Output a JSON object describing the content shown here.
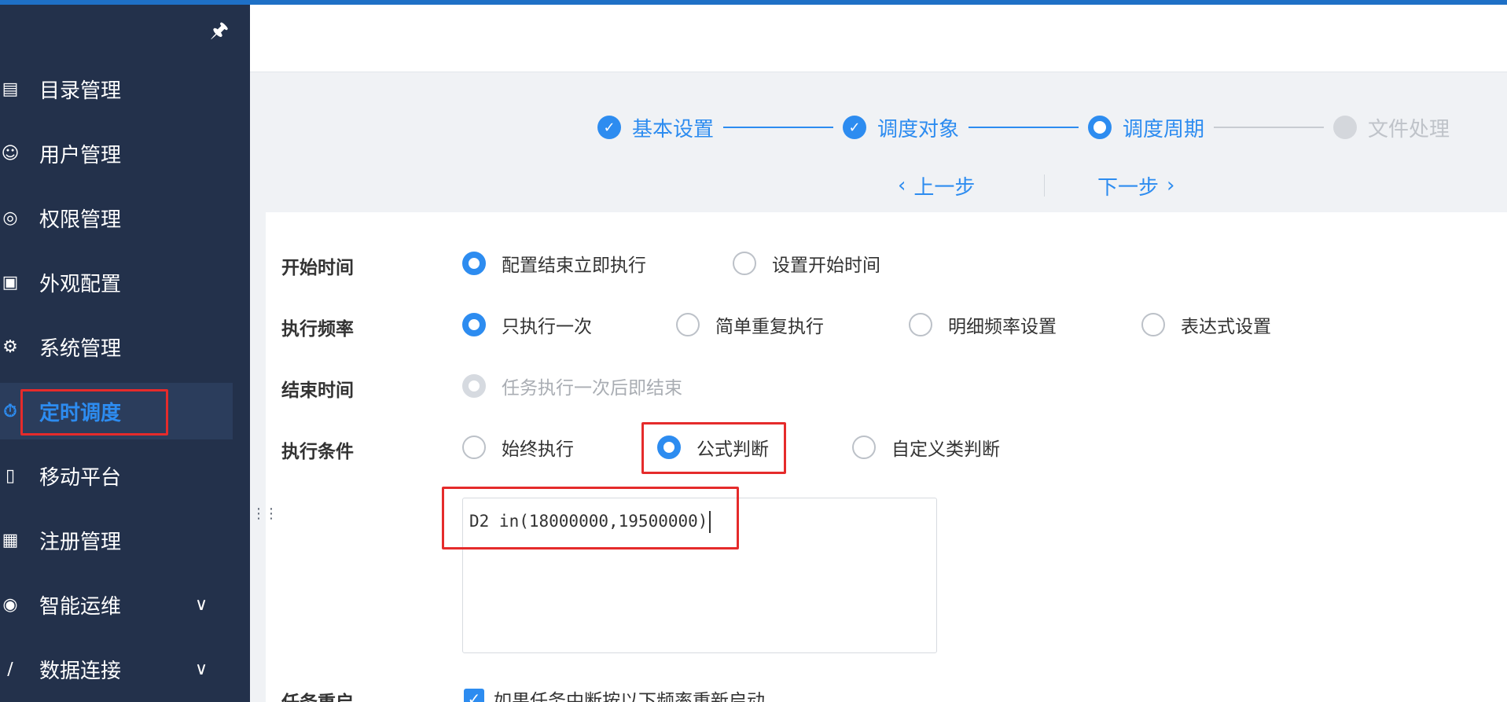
{
  "sidebar": {
    "items": [
      {
        "label": "目录管理",
        "icon": "catalog-icon"
      },
      {
        "label": "用户管理",
        "icon": "user-icon"
      },
      {
        "label": "权限管理",
        "icon": "shield-icon"
      },
      {
        "label": "外观配置",
        "icon": "paint-roller-icon"
      },
      {
        "label": "系统管理",
        "icon": "gear-icon"
      },
      {
        "label": "定时调度",
        "icon": "timer-icon",
        "active": true
      },
      {
        "label": "移动平台",
        "icon": "mobile-icon"
      },
      {
        "label": "注册管理",
        "icon": "register-icon"
      },
      {
        "label": "智能运维",
        "icon": "ops-icon",
        "expandable": true
      },
      {
        "label": "数据连接",
        "icon": "link-icon",
        "expandable": true
      }
    ]
  },
  "steps": [
    {
      "label": "基本设置",
      "state": "done"
    },
    {
      "label": "调度对象",
      "state": "done"
    },
    {
      "label": "调度周期",
      "state": "current"
    },
    {
      "label": "文件处理",
      "state": "pending"
    }
  ],
  "nav": {
    "prev": "上一步",
    "next": "下一步"
  },
  "form": {
    "start_time": {
      "label": "开始时间",
      "options": [
        "配置结束立即执行",
        "设置开始时间"
      ],
      "selected": 0
    },
    "frequency": {
      "label": "执行频率",
      "options": [
        "只执行一次",
        "简单重复执行",
        "明细频率设置",
        "表达式设置"
      ],
      "selected": 0
    },
    "end_time": {
      "label": "结束时间",
      "options": [
        "任务执行一次后即结束"
      ],
      "selected": 0
    },
    "condition": {
      "label": "执行条件",
      "options": [
        "始终执行",
        "公式判断",
        "自定义类判断"
      ],
      "selected": 1
    },
    "formula": "D2 in(18000000,19500000)",
    "restart": {
      "label": "任务重启",
      "checkbox_label": "如果任务中断按以下频率重新启动",
      "checked": true
    }
  },
  "colors": {
    "accent": "#2d8cf0",
    "sidebar_bg": "#23314b",
    "highlight": "#e52b2b",
    "topbar": "#1e70c6"
  }
}
